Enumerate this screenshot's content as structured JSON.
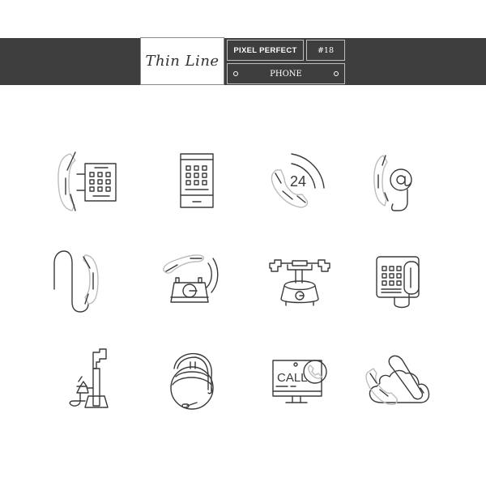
{
  "header": {
    "brand_title": "Thin Line",
    "tag": "PIXEL PERFECT",
    "number": "#18",
    "category": "PHONE"
  },
  "icons": [
    {
      "name": "desk-phone-keypad",
      "label": ""
    },
    {
      "name": "smartphone-keypad",
      "label": ""
    },
    {
      "name": "support-24-hours",
      "label": "24"
    },
    {
      "name": "phone-email",
      "label": "@"
    },
    {
      "name": "handset-cord",
      "label": ""
    },
    {
      "name": "ringing-rotary-phone",
      "label": ""
    },
    {
      "name": "vintage-candlestick-phone",
      "label": ""
    },
    {
      "name": "payphone",
      "label": ""
    },
    {
      "name": "antique-stand-phone",
      "label": ""
    },
    {
      "name": "headset-operator",
      "label": ""
    },
    {
      "name": "computer-call",
      "label": "CALL"
    },
    {
      "name": "cloud-phone",
      "label": ""
    }
  ]
}
